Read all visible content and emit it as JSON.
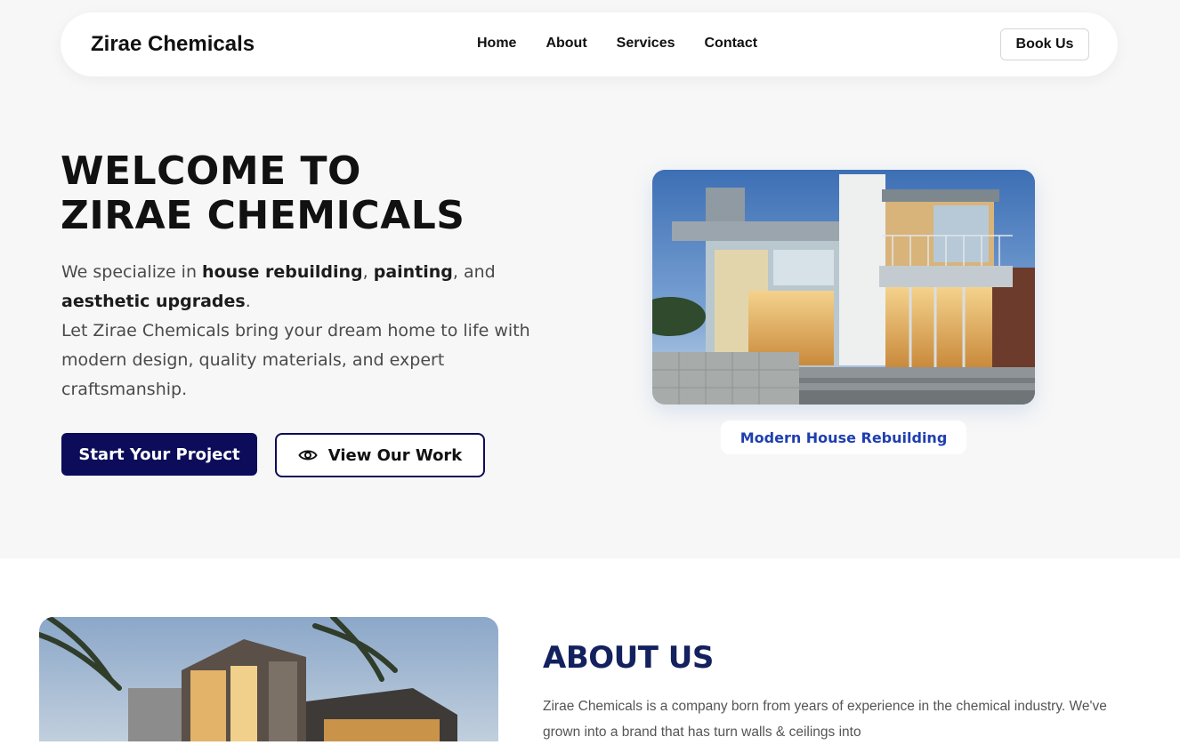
{
  "nav": {
    "brand": "Zirae Chemicals",
    "links": [
      "Home",
      "About",
      "Services",
      "Contact"
    ],
    "book_label": "Book Us"
  },
  "hero": {
    "title_line1": "WELCOME TO",
    "title_line2": "ZIRAE CHEMICALS",
    "intro_prefix": "We specialize in ",
    "intro_bold1": "house rebuilding",
    "intro_sep1": ", ",
    "intro_bold2": "painting",
    "intro_sep2": ", and ",
    "intro_bold3": "aesthetic upgrades",
    "intro_end": ".",
    "intro_line2": "Let Zirae Chemicals bring your dream home to life with modern design, quality materials, and expert craftsmanship.",
    "primary_button": "Start Your Project",
    "secondary_button": "View Our Work",
    "secondary_icon": "eye-icon",
    "image_caption": "Modern House Rebuilding"
  },
  "about": {
    "title": "ABOUT US",
    "text": "Zirae Chemicals is a company born from years of experience in the chemical industry. We've grown into a brand that has turn walls & ceilings into"
  },
  "colors": {
    "primary": "#0c0c5a",
    "caption": "#1f3fb0",
    "about_title": "#13215e",
    "hero_bg": "#f7f7f7"
  }
}
